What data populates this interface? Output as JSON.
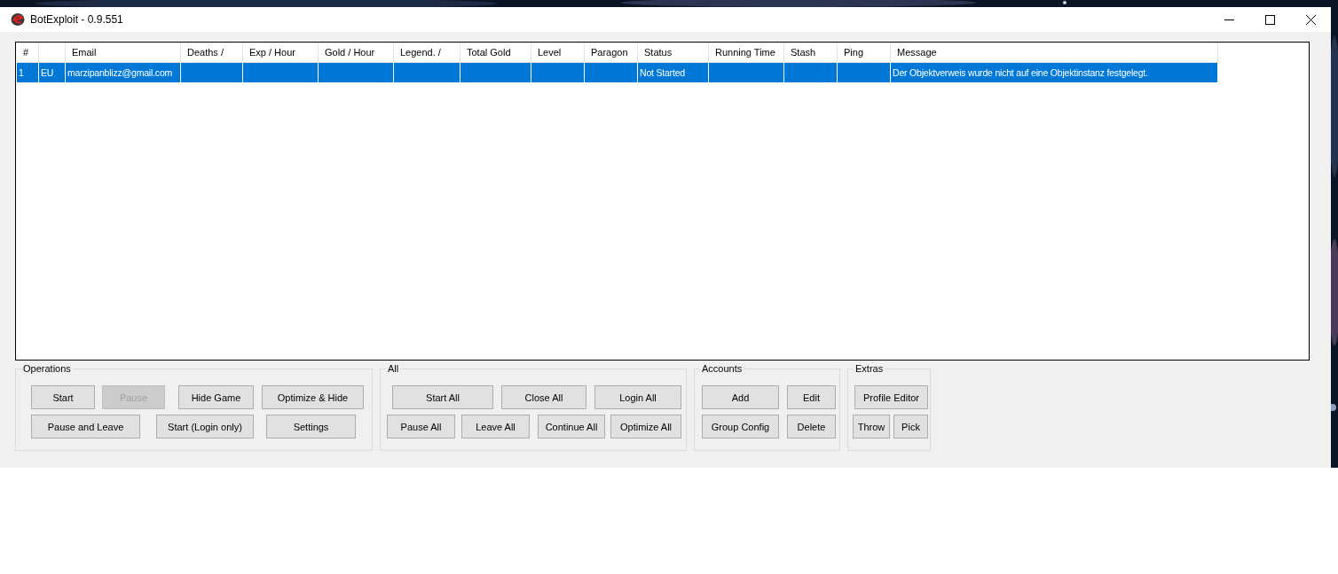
{
  "window": {
    "title": "BotExploit - 0.9.551"
  },
  "table": {
    "columns": [
      "#",
      null,
      "Email",
      "Deaths /",
      "Exp / Hour",
      "Gold / Hour",
      "Legend. /",
      "Total Gold",
      "Level",
      "Paragon",
      "Status",
      "Running Time",
      "Stash",
      "Ping",
      "Message"
    ],
    "rows": [
      {
        "selected": true,
        "cells": [
          "1",
          "EU",
          "marzipanblizz@gmail.com",
          null,
          null,
          null,
          null,
          null,
          null,
          null,
          "Not Started",
          null,
          null,
          null,
          "Der Objektverweis wurde nicht auf eine Objektinstanz festgelegt."
        ]
      }
    ]
  },
  "groups": [
    {
      "title": "Operations",
      "buttons": [
        {
          "label": "Start",
          "disabled": false
        },
        {
          "label": "Pause",
          "disabled": true
        },
        {
          "label": "Hide Game",
          "disabled": false
        },
        {
          "label": "Optimize & Hide",
          "disabled": false
        },
        {
          "label": "Pause and Leave",
          "disabled": false
        },
        {
          "label": "Start (Login only)",
          "disabled": false
        },
        {
          "label": "Settings",
          "disabled": false
        }
      ]
    },
    {
      "title": "All",
      "buttons": [
        {
          "label": "Start All",
          "disabled": false
        },
        {
          "label": "Close All",
          "disabled": false
        },
        {
          "label": "Login All",
          "disabled": false
        },
        {
          "label": "Pause All",
          "disabled": false
        },
        {
          "label": "Leave All",
          "disabled": false
        },
        {
          "label": "Continue All",
          "disabled": false
        },
        {
          "label": "Optimize All",
          "disabled": false
        }
      ]
    },
    {
      "title": "Accounts",
      "buttons": [
        {
          "label": "Add",
          "disabled": false
        },
        {
          "label": "Edit",
          "disabled": false
        },
        {
          "label": "Group Config",
          "disabled": false
        },
        {
          "label": "Delete",
          "disabled": false
        }
      ]
    },
    {
      "title": "Extras",
      "buttons": [
        {
          "label": "Profile Editor",
          "disabled": false
        },
        {
          "label": "Throw",
          "disabled": false
        },
        {
          "label": "Pick",
          "disabled": false
        }
      ]
    }
  ]
}
